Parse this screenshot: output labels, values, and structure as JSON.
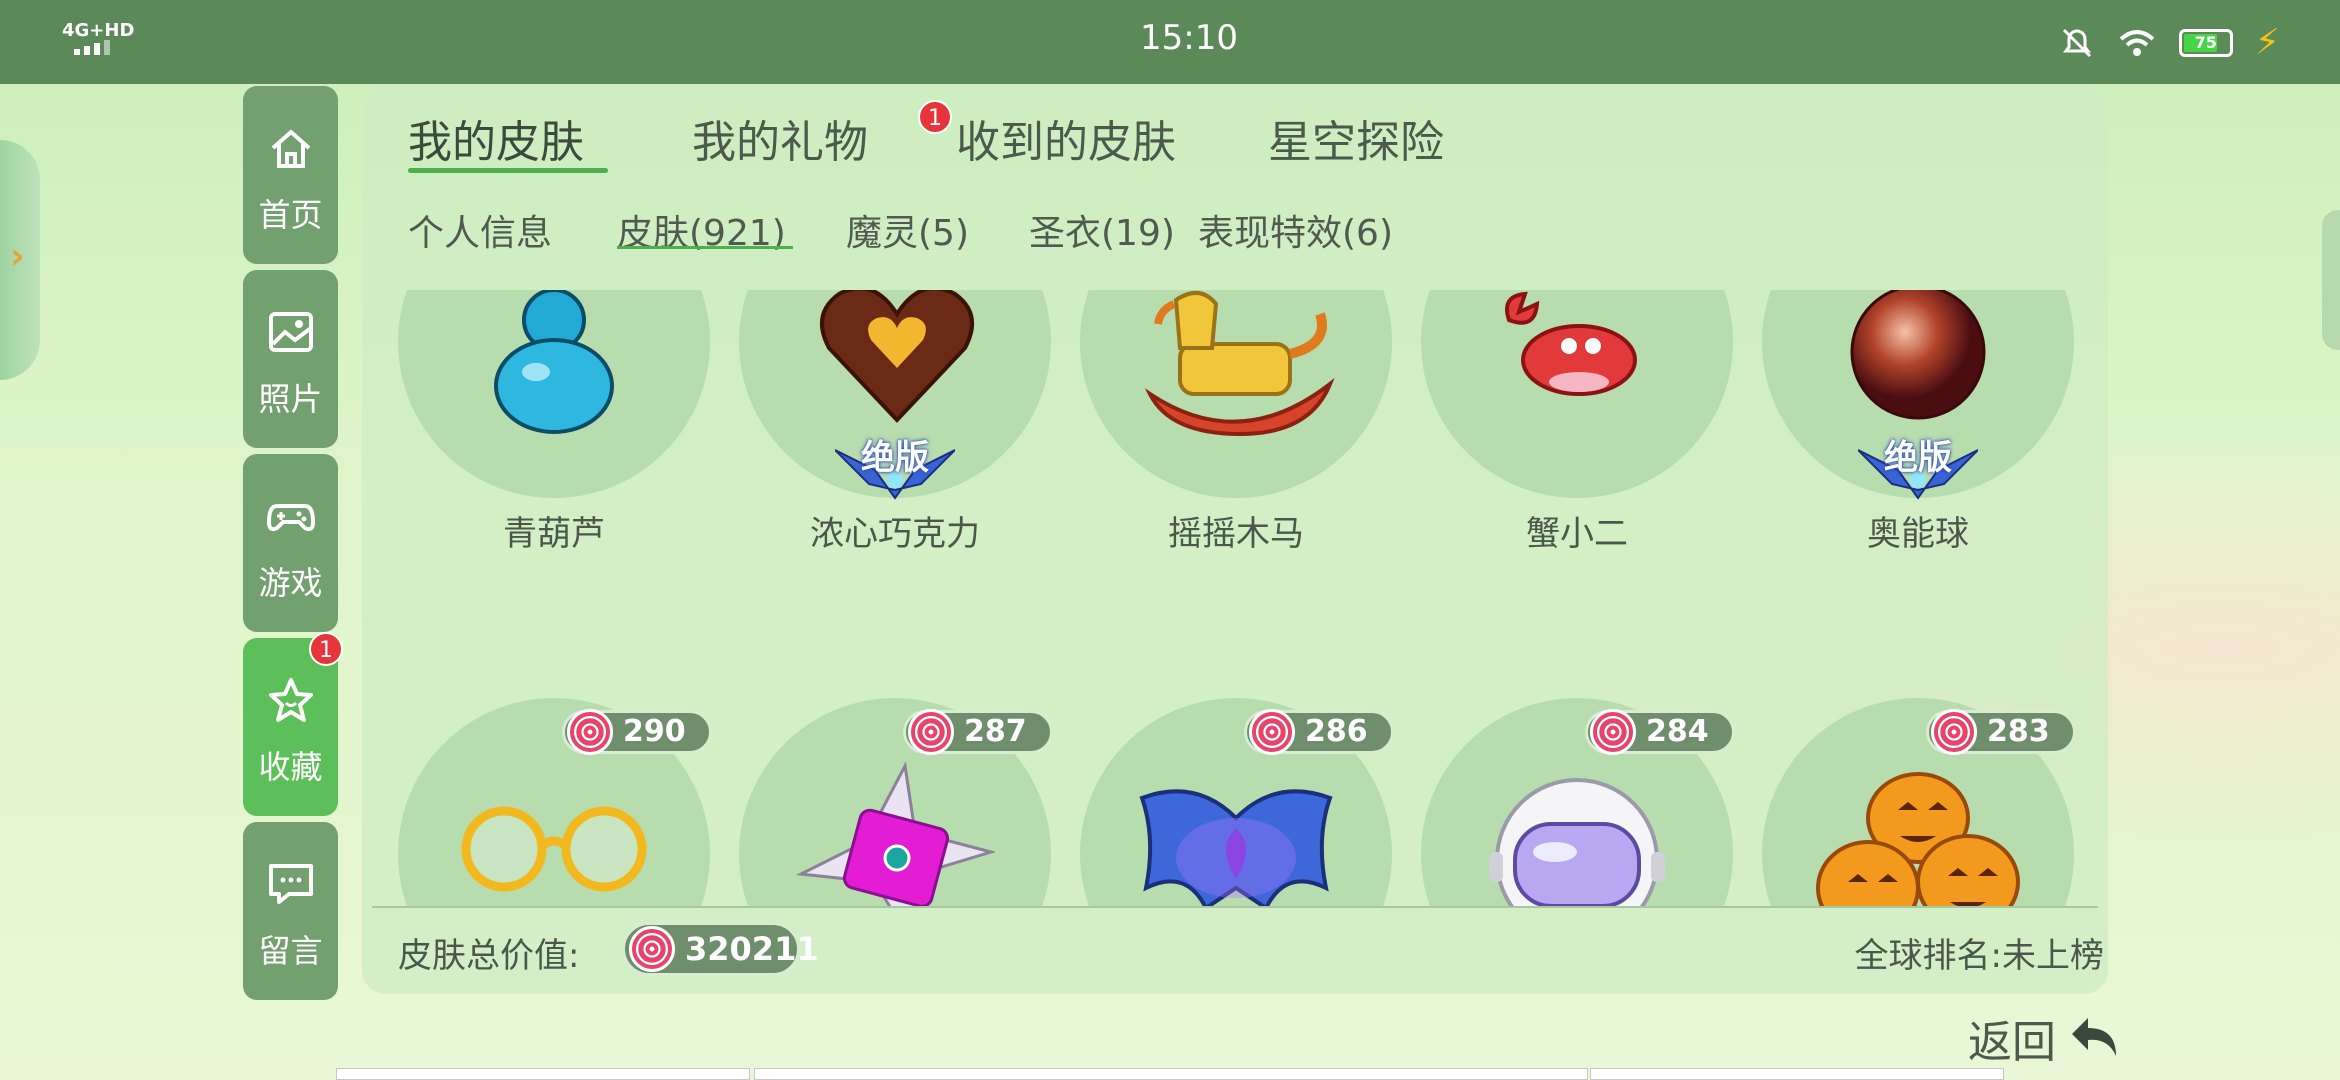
{
  "status_bar": {
    "network": "4G+HD",
    "time": "15:10",
    "battery": "75"
  },
  "nav": [
    {
      "label": "首页",
      "icon": "home-icon"
    },
    {
      "label": "照片",
      "icon": "photo-icon"
    },
    {
      "label": "游戏",
      "icon": "gamepad-icon"
    },
    {
      "label": "收藏",
      "icon": "star-icon",
      "badge": "1"
    },
    {
      "label": "留言",
      "icon": "message-icon"
    }
  ],
  "tabs": [
    {
      "label": "我的皮肤"
    },
    {
      "label": "我的礼物",
      "badge": "1"
    },
    {
      "label": "收到的皮肤"
    },
    {
      "label": "星空探险"
    }
  ],
  "subtabs": [
    {
      "label": "个人信息"
    },
    {
      "label": "皮肤(921)"
    },
    {
      "label": "魔灵(5)"
    },
    {
      "label": "圣衣(19)"
    },
    {
      "label": "表现特效(6)"
    }
  ],
  "skins_row1": [
    {
      "name": "青葫芦",
      "item": "blue-gourd"
    },
    {
      "name": "浓心巧克力",
      "item": "chocolate-heart",
      "tag": "绝版"
    },
    {
      "name": "摇摇木马",
      "item": "rocking-horse"
    },
    {
      "name": "蟹小二",
      "item": "crab"
    },
    {
      "name": "奥能球",
      "item": "energy-orb",
      "tag": "绝版"
    }
  ],
  "skins_row2": [
    {
      "price": "290",
      "item": "gold-glasses"
    },
    {
      "price": "287",
      "item": "shuriken"
    },
    {
      "price": "286",
      "item": "bat-wings"
    },
    {
      "price": "284",
      "item": "astronaut-helmet"
    },
    {
      "price": "283",
      "item": "pumpkins"
    }
  ],
  "footer": {
    "total_label": "皮肤总价值:",
    "total_value": "320211",
    "rank": "全球排名:未上榜"
  },
  "back_label": "返回",
  "colors": {
    "statusbar": "#5b8a58",
    "nav": "#73a06f",
    "nav_active": "#5cbf5a",
    "accent": "#4caf50",
    "badge": "#e7353a"
  }
}
